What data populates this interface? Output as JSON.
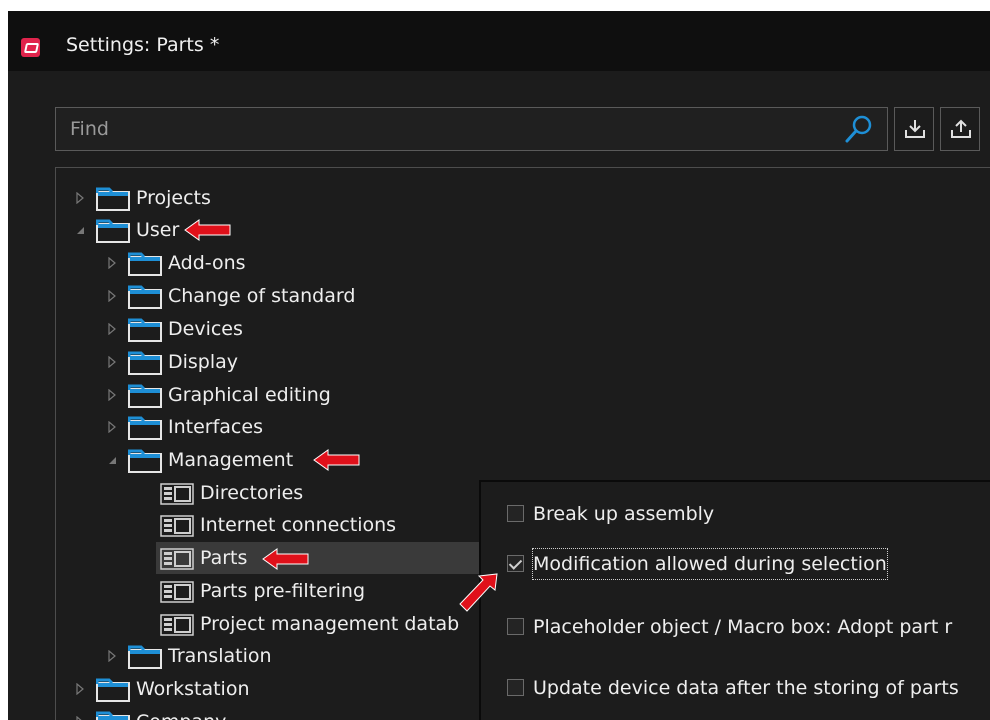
{
  "window": {
    "title": "Settings: Parts *"
  },
  "search": {
    "placeholder": "Find"
  },
  "toolbar": {
    "import_icon": "import-icon",
    "export_icon": "export-icon"
  },
  "tree": {
    "projects": "Projects",
    "user": "User",
    "addons": "Add-ons",
    "change_of_standard": "Change of standard",
    "devices": "Devices",
    "display": "Display",
    "graphical_editing": "Graphical editing",
    "interfaces": "Interfaces",
    "management": "Management",
    "directories": "Directories",
    "internet_connections": "Internet connections",
    "parts": "Parts",
    "parts_prefiltering": "Parts pre-filtering",
    "project_management_database": "Project management datab",
    "translation": "Translation",
    "workstation": "Workstation",
    "company": "Company"
  },
  "options": [
    {
      "label": "Break up assembly",
      "checked": false
    },
    {
      "label": "Modification allowed during selection",
      "checked": true
    },
    {
      "label": "Placeholder object / Macro box: Adopt part r",
      "checked": false
    },
    {
      "label": "Update device data after the storing of parts",
      "checked": false
    }
  ],
  "colors": {
    "accent": "#1e8fd6",
    "annotation_arrow": "#e0101a",
    "app_icon": "#e0244c"
  }
}
